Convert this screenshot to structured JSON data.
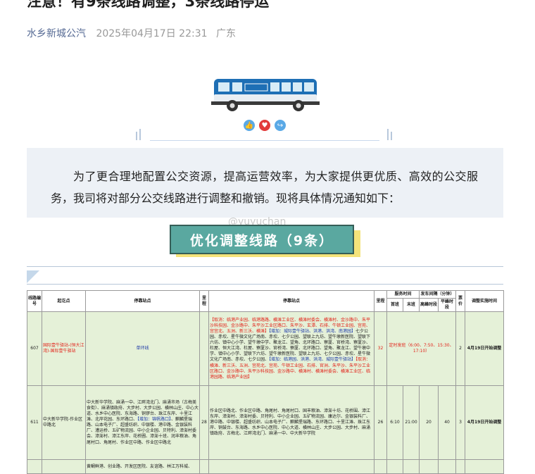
{
  "article": {
    "title": "注意！有9条线路调整，3条线路停运",
    "account": "水乡新城公汽",
    "date": "2025年04月17日 22:31",
    "location": "广东",
    "intro": "为了更合理地配置公交资源，提高运营效率，为大家提供更优质、高效的公交服务，我司将对部分公交线路进行调整和撤销。现将具体情况通知如下：",
    "watermark": "@yuyuchan",
    "section_title": "优化调整线路（9条）"
  },
  "colors": {
    "accent": "#5aa8a0",
    "highlight": "#f4e37a",
    "bus_blue": "#1e6fb5",
    "red_text": "#e2231a"
  },
  "icons": [
    "bus-illustration",
    "thumb-up-icon",
    "heart-icon",
    "share-icon"
  ],
  "table": {
    "headers": {
      "line_no": "线路编号",
      "start": "起讫点",
      "orig_stops": "停靠站点",
      "mileage_a": "里程",
      "new_stops": "停靠站点",
      "mileage_b": "里程",
      "service_time": "服务时间",
      "first": "首班",
      "last": "末班",
      "interval": "发车间隔（分钟）",
      "peak": "高峰时段",
      "offpeak": "平峰时段",
      "fare": "票价",
      "effective": "调整实施时间"
    },
    "rows": [
      {
        "line": "607",
        "start": "国际壹牛驿站-(恒大江湾)-国际壹牛驿站",
        "orig": "单环线",
        "mileage_a": "",
        "new_red1": "【取消：临港产业园、临港路路、横滩工业区、横滩村委会、横滩村、金沙路中、朱平沙科技园、金沙路中、朱平沙工业区路口、朱平沙、玄潭、石排、牛顿工业园、宫苑、宫宫北、五洲、新三沃、横滩】",
        "new_blue1": "【增加：城际壹牛驿站、洪港、洪湾、南港园】",
        "new_mid": "七夕公园、赤坎、星牛微文化广场南、赤坎、七夕公园、望联上九坊、望牛墩新医院、望联下六坊、镇中心小学、望牛墩中学、聚龙江、望角、北环路口、寮厦、官桥湾、寮厦沙、杜屋、恒大江湾、杜屋、寮厦沙、官桥湾、寮厦、北环路口、望角、聚龙江、望牛墩中学、镇中心小学、望联下六坊、望牛墩新医院、望联上九坊、七夕公园、赤坎、星牛微文化广场南、赤坎、七夕公园、",
        "new_blue2": "【增加：临港园、洪港、洪湾、城际壹牛驿站】",
        "new_red2": "【取消：横滩、新三沃、五洲、宫苑北、宫苑、牛顿工业园、石排、官洲、朱平沙、朱平沙工业区路口、金沙路中、朱平沙科技园、金沙路中、横滩村、横滩村委会、横滩工业区、临港园路、临港产业园】",
        "mileage_b": "32",
        "first": "定时发班（6:00、7:50、15:30、17:10）",
        "last": "",
        "peak": "",
        "offpeak": "",
        "fare": "2",
        "effective": "4月19日开始调整"
      },
      {
        "line": "611",
        "start": "中大新华学院-作业区中路北",
        "orig": "中大新华学院、麻涌一中、江畔湾北门、麻涌市场（古梅美食街）、麻涌镇政府、大步村、大步公园、横林山庄、中心大道、水乡中心医院、东海路、铜锣台、珠江东岸、十里江滩、北岸花园、东环路口、",
        "orig_blue": "【增加：锦帆路口】",
        "orig_tail": "、麒麟堡瑞路、山本电子厂、超盛纺织、中银楼、港中路、金银装料厂、漕运桥、五矿物流园、中小企业园、贝特利、漳澎村委会、漳澎村、漳江东岸、花桥圃、漳澎十班、润丰粮油、角尾村口、角尾村、作业区中路、作业区中路北",
        "mileage_a": "28",
        "new": "作业区中路北、作业区中路、角尾村、角尾村口、国丰粮油、漳澎十坊、花桥围、漳江东岸、漳澎村、漳澎村委、贝特利、中小企业园、五矿物流园、康达尔、金银装料厂、港中路、中银楼、超盛纺织、山本电子厂、麒麟堡瑞路、东环路口、十里江滩、珠江东岸、铜鼓台、东海路、水乡中心医院、中心大道、横林山庄、大步公园、大步村、麻涌镇政府、古梅北、江畔湾北门、麻涌一中、中大新华学院",
        "mileage_b": "26",
        "first": "6:10",
        "last": "21:00",
        "peak": "20",
        "offpeak": "40",
        "fare": "3",
        "effective": "4月19日开始调整"
      },
      {
        "line": "",
        "start": "",
        "orig": "黄鲷鲜港、创业路、开发区医院、友谊路、林江万科城、"
      }
    ]
  }
}
